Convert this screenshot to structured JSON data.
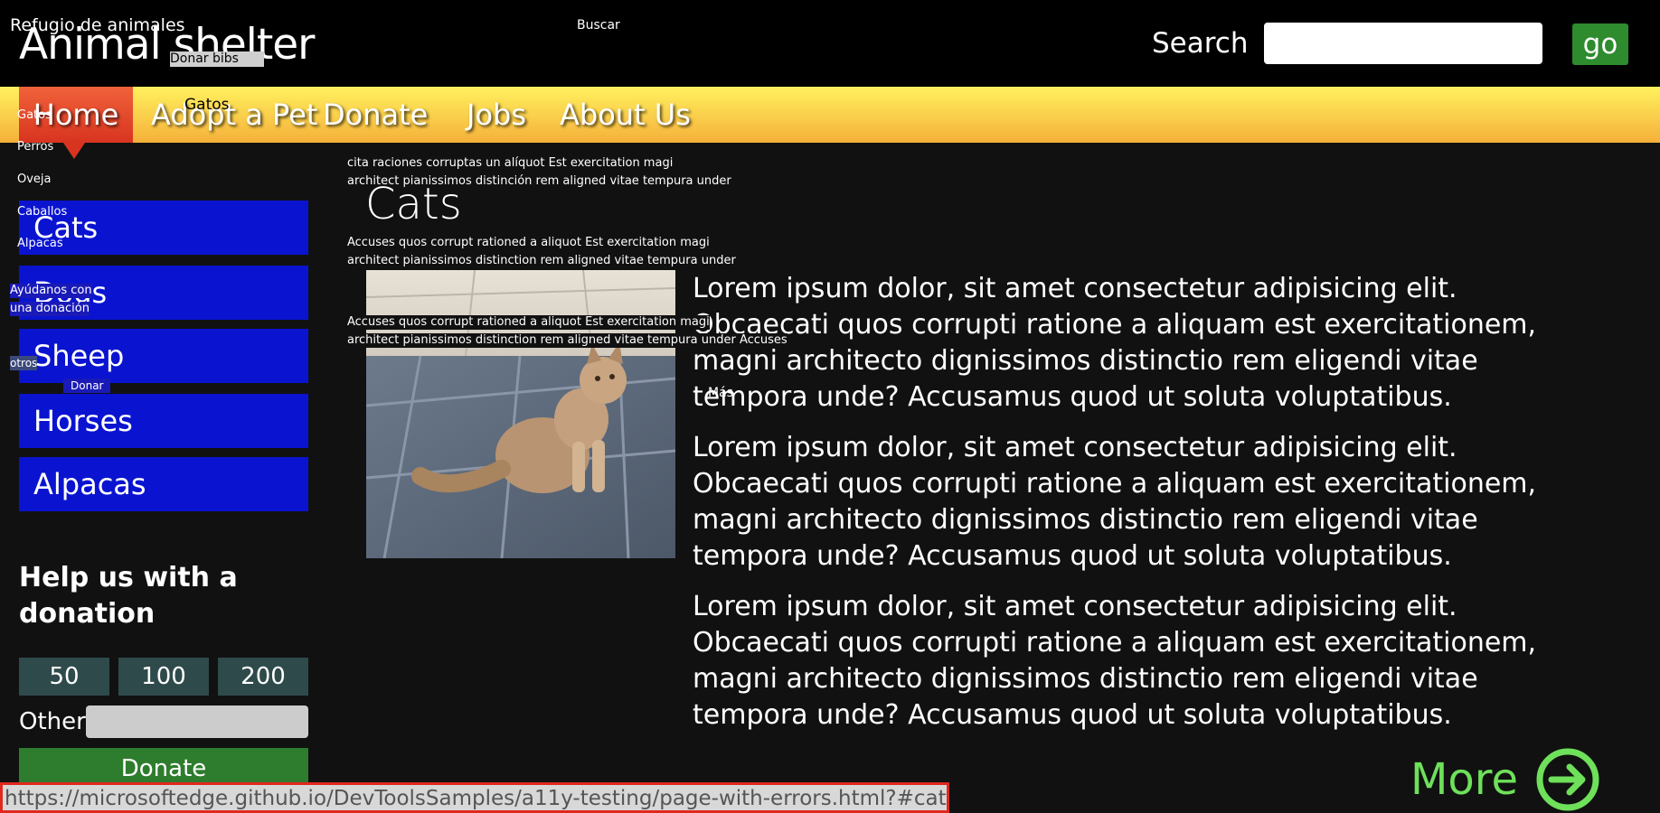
{
  "header": {
    "title": "Animal shelter",
    "search_label": "Search",
    "search_value": "",
    "go_label": "go"
  },
  "nav": {
    "items": [
      {
        "label": "Home"
      },
      {
        "label": "Adopt a Pet"
      },
      {
        "label": "Donate"
      },
      {
        "label": "Jobs"
      },
      {
        "label": "About Us"
      }
    ]
  },
  "sidebar": {
    "animals": [
      {
        "label": "Cats"
      },
      {
        "label": "Dogs"
      },
      {
        "label": "Sheep"
      },
      {
        "label": "Horses"
      },
      {
        "label": "Alpacas"
      }
    ],
    "donation": {
      "heading": "Help us with a donation",
      "amounts": [
        "50",
        "100",
        "200"
      ],
      "other_label": "Other",
      "other_value": "",
      "donate_label": "Donate"
    }
  },
  "main": {
    "heading": "Cats",
    "paragraphs": [
      "Lorem ipsum dolor, sit amet consectetur adipisicing elit. Obcaecati quos corrupti ratione a aliquam est exercitationem, magni architecto dignissimos distinctio rem eligendi vitae tempora unde? Accusamus quod ut soluta voluptatibus.",
      "Lorem ipsum dolor, sit amet consectetur adipisicing elit. Obcaecati quos corrupti ratione a aliquam est exercitationem, magni architecto dignissimos distinctio rem eligendi vitae tempora unde? Accusamus quod ut soluta voluptatibus.",
      "Lorem ipsum dolor, sit amet consectetur adipisicing elit. Obcaecati quos corrupti ratione a aliquam est exercitationem, magni architecto dignissimos distinctio rem eligendi vitae tempora unde? Accusamus quod ut soluta voluptatibus."
    ],
    "more_label": "More"
  },
  "overlay": {
    "refugio": "Refugio de animales",
    "buscar": "Buscar",
    "donar_bibs": "Donar bibs",
    "gatos_nav": "Gatos",
    "side": [
      "Gatos",
      "Perros",
      "Oveja",
      "Caballos",
      "Alpacas"
    ],
    "ayudanos_1": "Ayúdanos con",
    "ayudanos_2": "una donación",
    "otros": "otros",
    "donar": "Donar",
    "spanish_1a": "cita raciones corruptas un alíquot Est exercitation magi",
    "spanish_1b": "architect pianissimos distinción rem aligned vitae tempura under",
    "spanish_2a": "Accuses quos corrupt rationed a aliquot Est exercitation magi",
    "spanish_2b": "architect pianissimos distinction rem aligned vitae tempura under",
    "spanish_3a": "Accuses quos corrupt rationed a aliquot Est exercitation magi",
    "spanish_3b": "architect pianissimos distinction rem aligned vitae tempura under Accuses",
    "mas": "Más"
  },
  "status_bar": {
    "url": "https://microsoftedge.github.io/DevToolsSamples/a11y-testing/page-with-errors.html?#cats"
  },
  "colors": {
    "header_bg": "#000000",
    "nav_gradient": [
      "#fff15e",
      "#f5b03a"
    ],
    "home_active": "#d83420",
    "sidebar_button": "#0a14d0",
    "amount_button": "#2f4a4a",
    "donate_button": "#2e7d2e",
    "more_accent": "#6ee05a",
    "status_border": "#e0281e"
  }
}
